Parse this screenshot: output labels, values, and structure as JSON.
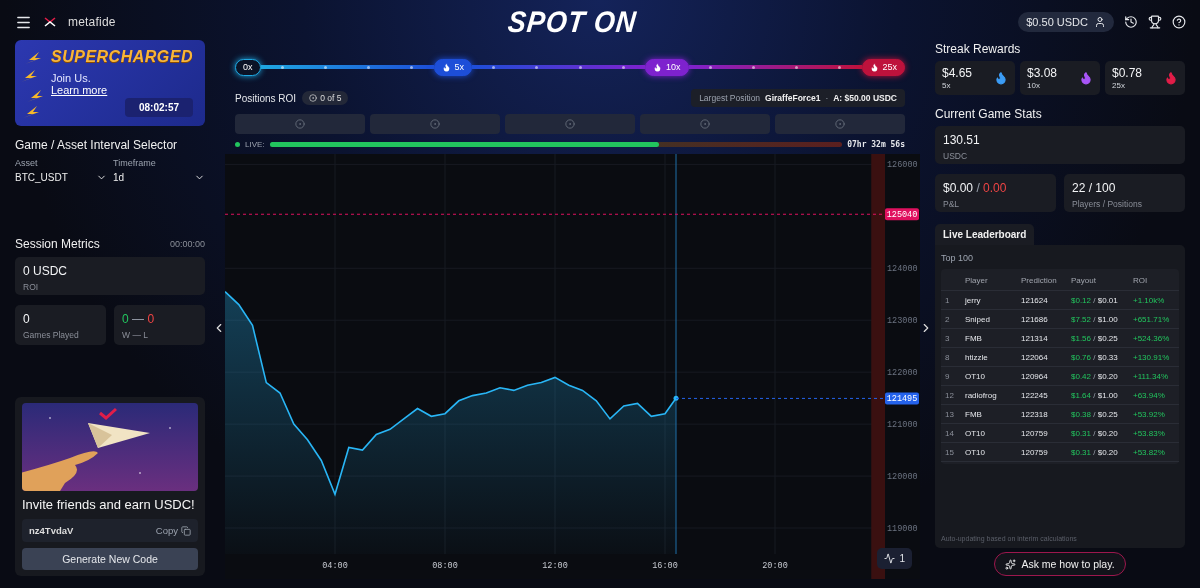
{
  "header": {
    "logo": "metafide",
    "title": "SPOT ON",
    "balance": "$0.50 USDC"
  },
  "promo": {
    "title": "SUPERCHARGED",
    "text": "Join Us.",
    "link": "Learn more",
    "timer": "08:02:57"
  },
  "selector": {
    "title": "Game / Asset Interval Selector",
    "fields": [
      {
        "label": "Asset",
        "value": "BTC_USDT"
      },
      {
        "label": "Timeframe",
        "value": "1d"
      }
    ]
  },
  "session": {
    "title": "Session Metrics",
    "timer": "00:00:00",
    "roi": {
      "value": "0 USDC",
      "label": "ROI"
    },
    "games": {
      "value": "0",
      "label": "Games Played"
    },
    "record": {
      "wins": "0",
      "separator": "—",
      "losses": "0",
      "label": "W — L"
    }
  },
  "invite": {
    "title": "Invite friends and earn USDC!",
    "code": "nz4TvdaV",
    "copy": "Copy",
    "button": "Generate New Code"
  },
  "multipliers": [
    {
      "label": "0x",
      "kind": "start",
      "color": "#1ea7e1"
    },
    {
      "label": "5x",
      "kind": "flame",
      "color": "#1d4ed8"
    },
    {
      "label": "10x",
      "kind": "flame",
      "color": "#7e22ce"
    },
    {
      "label": "25x",
      "kind": "flame",
      "color": "#be123c"
    }
  ],
  "positions": {
    "title": "Positions ROI",
    "count": "0 of 5",
    "largest_label": "Largest Position",
    "largest_player": "GiraffeForce1",
    "separator": "·",
    "amount": "A: $50.00 USDC",
    "slots": [
      {
        "kind": "empty"
      },
      {
        "kind": "empty"
      },
      {
        "kind": "empty"
      },
      {
        "kind": "empty"
      },
      {
        "kind": "empty"
      }
    ]
  },
  "live": {
    "label": "LIVE:",
    "level": 0.68,
    "remaining": "07hr 32m 56s"
  },
  "chart": {
    "chart_data": {
      "type": "area",
      "x": [
        0,
        0.5,
        1,
        1.5,
        2,
        2.5,
        3,
        3.5,
        4,
        4.5,
        5,
        5.5,
        6,
        6.5,
        7,
        7.5,
        8,
        8.5,
        9,
        9.5,
        10,
        10.5,
        11,
        11.5,
        12,
        12.5,
        13,
        13.5,
        14,
        14.5,
        15,
        15.5,
        16,
        16.4
      ],
      "series": [
        {
          "color": "#29b6f6",
          "values": [
            123550,
            123300,
            122900,
            121800,
            121600,
            121000,
            120700,
            120300,
            119650,
            120550,
            120500,
            120800,
            120900,
            121100,
            121300,
            121150,
            121200,
            121450,
            121550,
            121600,
            121700,
            121650,
            121750,
            121800,
            121900,
            121750,
            121650,
            121450,
            121100,
            121350,
            121400,
            121150,
            121200,
            121500
          ]
        }
      ],
      "xlim": [
        0,
        24
      ],
      "ylim": [
        118500,
        126200
      ],
      "grid": true,
      "xticks": [
        {
          "value": 4,
          "label": "04:00"
        },
        {
          "value": 8,
          "label": "08:00"
        },
        {
          "value": 12,
          "label": "12:00"
        },
        {
          "value": 16,
          "label": "16:00"
        },
        {
          "value": 20,
          "label": "20:00"
        }
      ],
      "yticks": [
        119000,
        120000,
        121000,
        122000,
        123000,
        124000,
        126000
      ],
      "bands": [
        {
          "axis": "x",
          "from": 23.5,
          "to": 24,
          "color": "#3a1010"
        }
      ],
      "ref_lines": [
        {
          "axis": "y",
          "value": 125040,
          "label": "125040",
          "color": "#e0115f"
        },
        {
          "axis": "y",
          "value": 121495,
          "label": "121495",
          "color": "#2563eb"
        },
        {
          "axis": "x",
          "value": 16.4,
          "color": "#1e6fa8"
        }
      ]
    },
    "indicator": "1"
  },
  "streak": {
    "title": "Streak Rewards",
    "items": [
      {
        "amount": "$4.65",
        "multiplier": "5x",
        "color": "#3b9cf5"
      },
      {
        "amount": "$3.08",
        "multiplier": "10x",
        "color": "#a855f7"
      },
      {
        "amount": "$0.78",
        "multiplier": "25x",
        "color": "#e11d48"
      }
    ]
  },
  "stats": {
    "title": "Current Game Stats",
    "pool": {
      "value": "130.51",
      "label": "USDC"
    },
    "pnl": {
      "value": "$0.00",
      "separator": "/",
      "change": "0.00",
      "label": "P&L"
    },
    "players": {
      "value": "22 / 100",
      "label": "Players / Positions"
    }
  },
  "leaderboard": {
    "tabs": [
      {
        "label": "Live Leaderboard",
        "selected": true
      }
    ],
    "subtitle": "Top 100",
    "columns": [
      "Player",
      "Prediction",
      "Payout",
      "ROI"
    ],
    "rows": [
      {
        "rank": "1",
        "player": "jerry",
        "prediction": "121624",
        "payout": "$0.12",
        "separator": "/",
        "stake": "$0.01",
        "roi": "+1.10k%"
      },
      {
        "rank": "2",
        "player": "Sniped",
        "prediction": "121686",
        "payout": "$7.52",
        "separator": "/",
        "stake": "$1.00",
        "roi": "+651.71%"
      },
      {
        "rank": "3",
        "player": "FMB",
        "prediction": "121314",
        "payout": "$1.56",
        "separator": "/",
        "stake": "$0.25",
        "roi": "+524.36%"
      },
      {
        "rank": "8",
        "player": "htizzle",
        "prediction": "122064",
        "payout": "$0.76",
        "separator": "/",
        "stake": "$0.33",
        "roi": "+130.91%"
      },
      {
        "rank": "9",
        "player": "OT10",
        "prediction": "120964",
        "payout": "$0.42",
        "separator": "/",
        "stake": "$0.20",
        "roi": "+111.34%"
      },
      {
        "rank": "12",
        "player": "radiofrog",
        "prediction": "122245",
        "payout": "$1.64",
        "separator": "/",
        "stake": "$1.00",
        "roi": "+63.94%"
      },
      {
        "rank": "13",
        "player": "FMB",
        "prediction": "122318",
        "payout": "$0.38",
        "separator": "/",
        "stake": "$0.25",
        "roi": "+53.92%"
      },
      {
        "rank": "14",
        "player": "OT10",
        "prediction": "120759",
        "payout": "$0.31",
        "separator": "/",
        "stake": "$0.20",
        "roi": "+53.83%"
      },
      {
        "rank": "15",
        "player": "OT10",
        "prediction": "120759",
        "payout": "$0.31",
        "separator": "/",
        "stake": "$0.20",
        "roi": "+53.82%"
      }
    ],
    "footnote": "Auto-updating based on interim calculations"
  },
  "ask": "Ask me how to play."
}
